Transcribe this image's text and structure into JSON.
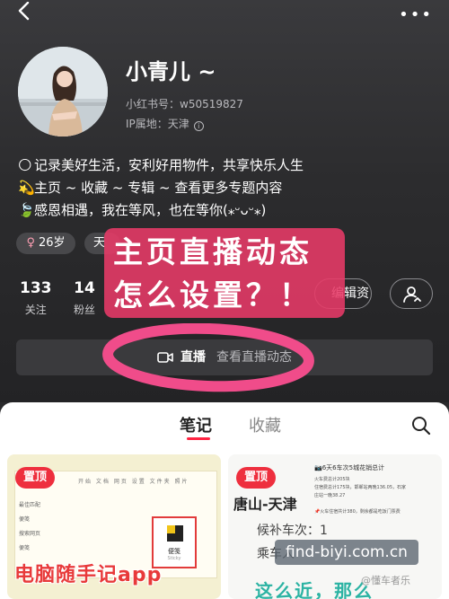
{
  "profile": {
    "nickname": "小青儿 ~",
    "redbook_id": "小红书号：w50519827",
    "ip_location": "IP属地：天津",
    "info_symbol": "i",
    "bio": [
      {
        "emoji": "🌕",
        "text": "记录美好生活，安利好用物件，共享快乐人生"
      },
      {
        "emoji": "💫",
        "text": "主页 ~ 收藏 ~ 专辑 ~ 查看更多专题内容"
      },
      {
        "emoji": "🍃",
        "text": "感恩相遇，我在等风，也在等你(⁎ᵕᴗᵕ⁎)"
      }
    ],
    "tags": {
      "age": "26岁",
      "age_symbol": "♀",
      "city": "天"
    }
  },
  "stats": {
    "following": {
      "num": "133",
      "label": "关注"
    },
    "fans": {
      "num": "14",
      "label": "粉丝"
    }
  },
  "actions": {
    "edit_label": "编辑资料"
  },
  "live": {
    "label": "直播",
    "sub": "查看直播动态"
  },
  "overlay": {
    "line1": "主页直播动态",
    "line2": "怎么设置？！"
  },
  "tabs": {
    "notes": "笔记",
    "collect": "收藏"
  },
  "cards": [
    {
      "pin": "置顶",
      "title": "电脑随手记app",
      "app_name": "便笺",
      "app_sub": "Sticky",
      "toolbar": "开始 文档 网页 设置 文件夹 照片",
      "side": [
        "最佳匹配",
        "便笺",
        "搜索网页",
        "便笺"
      ]
    },
    {
      "pin": "置顶",
      "route": "唐山-天津",
      "line1": "候补车次：1",
      "line2": "乘车人",
      "mini_title": "📷6天6车次5城花销总计",
      "mini_lines": [
        "火车费总计205块",
        "住宿费总计175块，邯郸站两晚136.05，石家",
        "庄站一晚38.27",
        "📌火车住宿共计380，剩余都是吃饭门票费"
      ],
      "bottom": "这么近，那么"
    }
  ],
  "watermark": {
    "url": "find-biyi.com.cn",
    "author": "@懂车者乐"
  }
}
